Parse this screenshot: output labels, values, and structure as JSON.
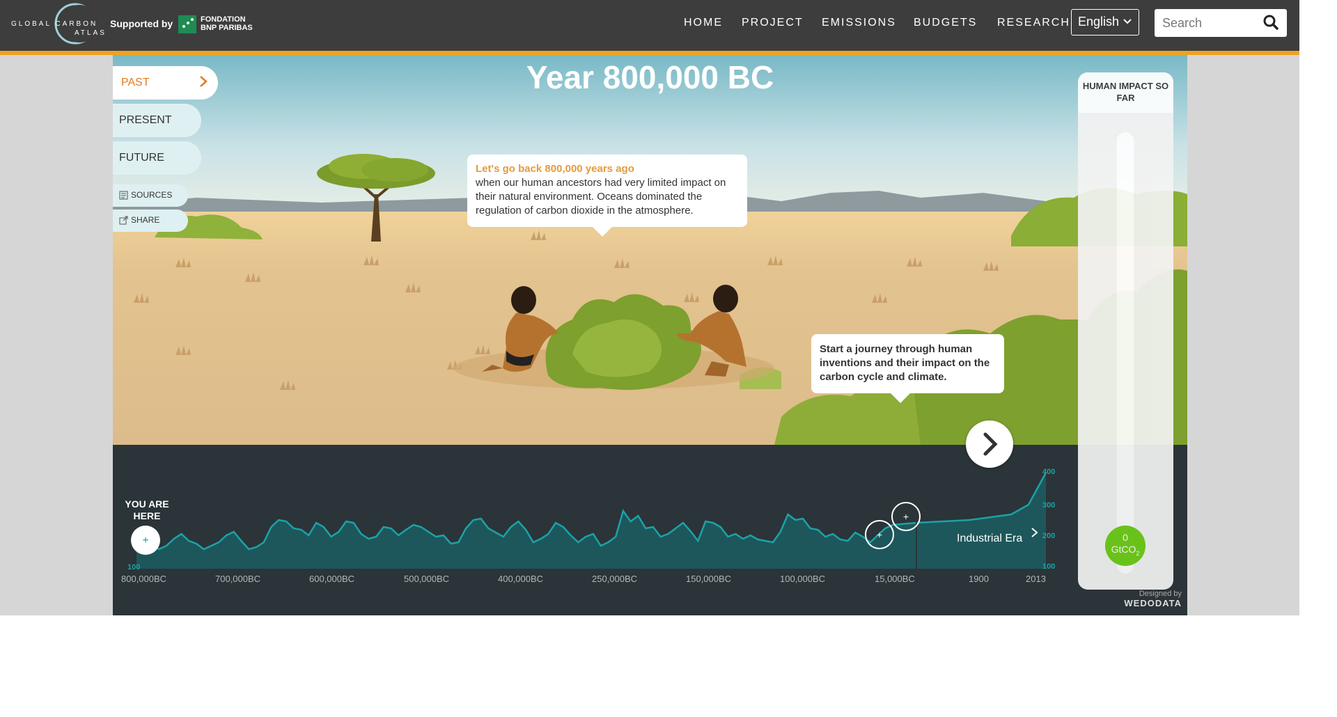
{
  "header": {
    "logo": {
      "line1": "GLOBAL CARBON",
      "line2": "ATLAS"
    },
    "supported_by": "Supported by",
    "sponsor": {
      "line1": "FONDATION",
      "line2": "BNP PARIBAS"
    },
    "nav": [
      "HOME",
      "PROJECT",
      "EMISSIONS",
      "BUDGETS",
      "RESEARCH"
    ],
    "language": "English",
    "search_placeholder": "Search"
  },
  "scene": {
    "year_title": "Year 800,000 BC",
    "tabs": {
      "past": "PAST",
      "present": "PRESENT",
      "future": "FUTURE"
    },
    "sources": "SOURCES",
    "share": "SHARE",
    "bubble1": {
      "heading": "Let's go back 800,000 years ago",
      "body": "when our human ancestors had very limited impact on their natural environment. Oceans dominated the regulation of carbon dioxide in the atmosphere."
    },
    "bubble2": "Start a journey through human inventions and their impact on the carbon cycle and climate."
  },
  "timeline": {
    "you_are_here": "YOU ARE HERE",
    "industrial_era": "Industrial Era",
    "x_labels": [
      "800,000BC",
      "700,000BC",
      "600,000BC",
      "500,000BC",
      "400,000BC",
      "250,000BC",
      "150,000BC",
      "100,000BC",
      "15,000BC",
      "1900",
      "2013"
    ],
    "y_labels": [
      "400",
      "300",
      "200",
      "100"
    ],
    "left_y_label": "100",
    "credit_line1": "Designed by",
    "credit_line2": "WEDODATA"
  },
  "impact": {
    "title": "HUMAN IMPACT SO FAR",
    "value": "0",
    "unit": "GtCO",
    "unit_sub": "2"
  },
  "colors": {
    "accent": "#f0a21f",
    "past_tab": "#e07b24",
    "chart_line": "#1aa3a8",
    "gauge": "#6fcf17"
  }
}
